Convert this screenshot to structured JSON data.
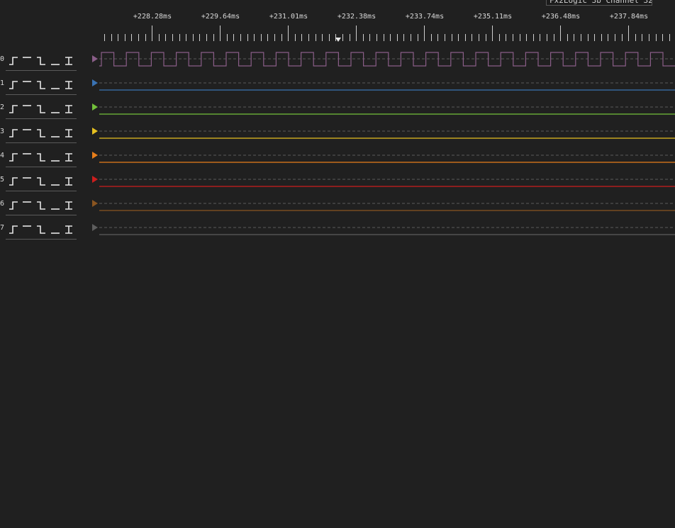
{
  "device": {
    "label": "Fx2Logic 3b Channel 32"
  },
  "timeline": {
    "labels": [
      "+228.28ms",
      "+229.64ms",
      "+231.01ms",
      "+232.38ms",
      "+233.74ms",
      "+235.11ms",
      "+236.48ms",
      "+237.84ms"
    ]
  },
  "channels": [
    {
      "num": "0",
      "color": "#8a5e88",
      "signal": "clock"
    },
    {
      "num": "1",
      "color": "#3a73b4",
      "signal": "low"
    },
    {
      "num": "2",
      "color": "#73c13b",
      "signal": "low"
    },
    {
      "num": "3",
      "color": "#e6c020",
      "signal": "low"
    },
    {
      "num": "4",
      "color": "#e87e1a",
      "signal": "low"
    },
    {
      "num": "5",
      "color": "#cc1e1e",
      "signal": "low"
    },
    {
      "num": "6",
      "color": "#8a5520",
      "signal": "low"
    },
    {
      "num": "7",
      "color": "#5e5e5e",
      "signal": "low"
    }
  ],
  "icons": [
    "rising-edge-icon",
    "high-level-icon",
    "falling-edge-icon",
    "low-level-icon",
    "any-edge-icon"
  ]
}
